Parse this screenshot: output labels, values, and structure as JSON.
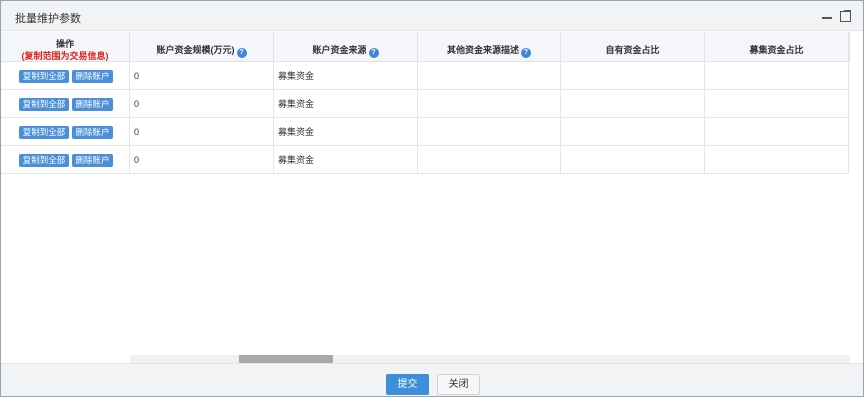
{
  "dialog": {
    "title": "批量维护参数"
  },
  "table": {
    "op_header": "操作",
    "op_subheader": "(复制范围为交易信息)",
    "headers": [
      "账户资金规模(万元)",
      "账户资金来源",
      "其他资金来源描述",
      "自有资金占比",
      "募集资金占比"
    ],
    "row_actions": {
      "copy_all": "复制到全部",
      "delete_account": "删除账户"
    },
    "rows": [
      {
        "scale": "0",
        "source": "募集资金",
        "other_desc": "",
        "own_ratio": "",
        "raised_ratio": ""
      },
      {
        "scale": "0",
        "source": "募集资金",
        "other_desc": "",
        "own_ratio": "",
        "raised_ratio": ""
      },
      {
        "scale": "0",
        "source": "募集资金",
        "other_desc": "",
        "own_ratio": "",
        "raised_ratio": ""
      },
      {
        "scale": "0",
        "source": "募集资金",
        "other_desc": "",
        "own_ratio": "",
        "raised_ratio": ""
      }
    ],
    "help_icon_glyph": "?"
  },
  "footer": {
    "submit_label": "提交",
    "close_label": "关闭"
  },
  "theme": {
    "accent": "#3e8ed8",
    "required_red": "#e02020"
  }
}
